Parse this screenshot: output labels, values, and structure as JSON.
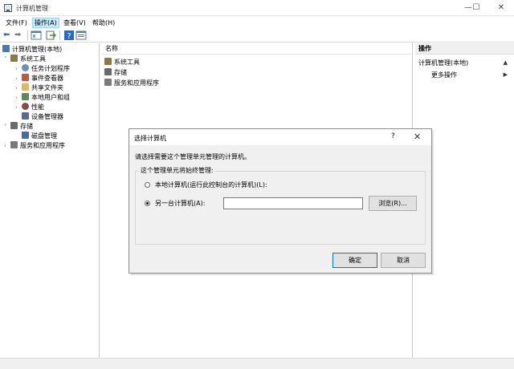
{
  "window": {
    "title": "计算机管理",
    "minimize": "—",
    "maximize": "☐",
    "close": "✕"
  },
  "menu": {
    "items": [
      "文件(F)",
      "操作(A)",
      "查看(V)",
      "帮助(H)"
    ],
    "active_index": 1
  },
  "toolbar": {
    "icons": [
      "back-arrow-icon",
      "forward-arrow-icon",
      "show-tree-icon",
      "export-icon",
      "help-icon",
      "properties-icon"
    ],
    "back": "⬅",
    "forward": "➡"
  },
  "tree": {
    "items": [
      {
        "label": "计算机管理(本地)",
        "icon": "computer-management-icon",
        "color": "#4a78b5",
        "arrow": ""
      },
      {
        "label": "系统工具",
        "icon": "system-tools-icon",
        "color": "#8a7a4a",
        "arrow": "˅"
      },
      {
        "label": "任务计划程序",
        "icon": "clock-icon",
        "color": "#6b8fb8",
        "arrow": "›"
      },
      {
        "label": "事件查看器",
        "icon": "event-viewer-icon",
        "color": "#c05a3a",
        "arrow": "›"
      },
      {
        "label": "共享文件夹",
        "icon": "shared-folder-icon",
        "color": "#e0b85a",
        "arrow": "›"
      },
      {
        "label": "本地用户和组",
        "icon": "users-icon",
        "color": "#5a8a5a",
        "arrow": "›"
      },
      {
        "label": "性能",
        "icon": "performance-icon",
        "color": "#8a4a4a",
        "arrow": "›"
      },
      {
        "label": "设备管理器",
        "icon": "device-manager-icon",
        "color": "#5a6a8a",
        "arrow": ""
      },
      {
        "label": "存储",
        "icon": "storage-icon",
        "color": "#6a6a6a",
        "arrow": "˅"
      },
      {
        "label": "磁盘管理",
        "icon": "disk-icon",
        "color": "#4a6a9a",
        "arrow": ""
      },
      {
        "label": "服务和应用程序",
        "icon": "services-icon",
        "color": "#7a7a7a",
        "arrow": "›"
      }
    ]
  },
  "list": {
    "header": "名称",
    "items": [
      {
        "label": "系统工具",
        "icon": "system-tools-icon",
        "color": "#8a7a4a"
      },
      {
        "label": "存储",
        "icon": "storage-icon",
        "color": "#6a6a6a"
      },
      {
        "label": "服务和应用程序",
        "icon": "services-icon",
        "color": "#7a7a7a"
      }
    ]
  },
  "actions": {
    "header": "操作",
    "group": "计算机管理(本地)",
    "group_arrow": "▲",
    "more": "更多操作",
    "more_arrow": "▶"
  },
  "dialog": {
    "title": "选择计算机",
    "help": "?",
    "close": "✕",
    "prompt": "请选择需要这个管理单元管理的计算机。",
    "group_label": "这个管理单元将始终管理:",
    "option_local": "本地计算机(运行此控制台的计算机)(L):",
    "option_remote": "另一台计算机(A):",
    "selected_option": "remote",
    "remote_value": "",
    "browse": "浏览(R)...",
    "ok": "确定",
    "cancel": "取消"
  },
  "colors": {
    "menu_highlight": "#cce8ff",
    "dialog_background": "#f0f0f0",
    "default_button_border": "#0078d7"
  }
}
